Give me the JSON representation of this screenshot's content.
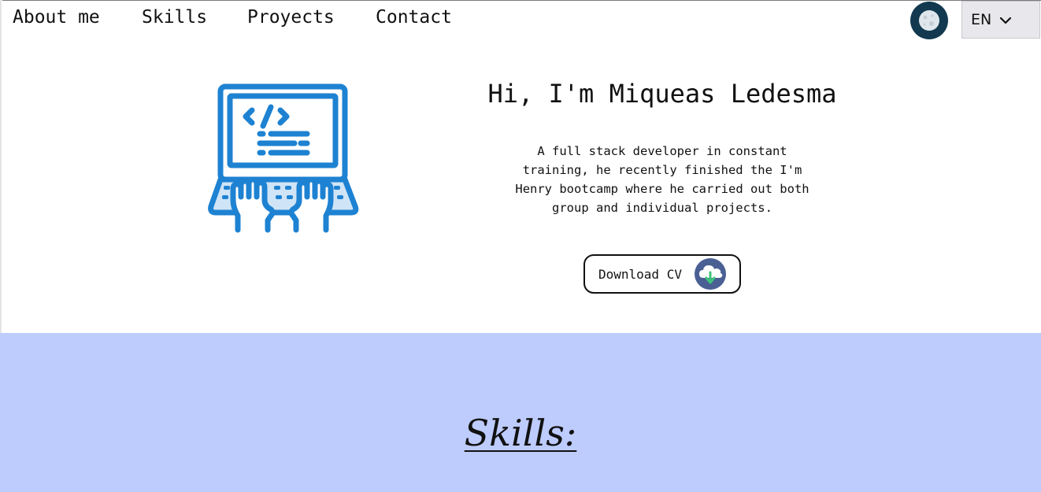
{
  "nav": {
    "links": [
      "About me",
      "Skills",
      "Proyects",
      "Contact"
    ],
    "language": "EN",
    "theme_icon": "moon-icon",
    "language_icon": "chevron-down-icon"
  },
  "hero": {
    "title": "Hi, I'm Miqueas Ledesma",
    "description": "A full stack developer in constant training, he recently finished the I'm Henry bootcamp where he carried out both group and individual projects.",
    "illustration_icon": "laptop-code-icon",
    "cv_button": {
      "label": "Download CV",
      "icon": "cloud-download-icon"
    }
  },
  "skills": {
    "title": "Skills:"
  },
  "colors": {
    "accent_blue": "#1e82d2",
    "skills_background": "#bdccfd",
    "theme_toggle": "#12394f",
    "cv_icon_bg": "#4a5f94",
    "download_arrow": "#3ec47a"
  }
}
